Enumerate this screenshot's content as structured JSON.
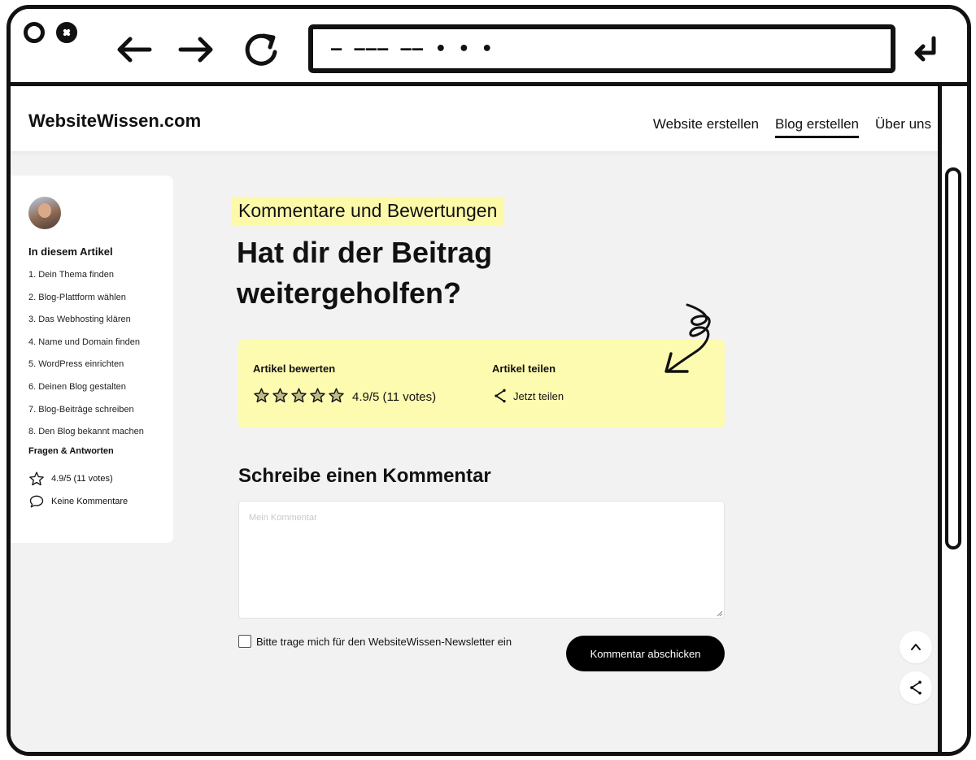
{
  "browser": {
    "url_text": "— ——— —— • • •"
  },
  "site": {
    "logo": "WebsiteWissen.com",
    "nav": [
      {
        "label": "Website erstellen",
        "active": false
      },
      {
        "label": "Blog erstellen",
        "active": true
      },
      {
        "label": "Über uns",
        "active": false
      }
    ]
  },
  "sidebar": {
    "title": "In diesem Artikel",
    "items": [
      "1. Dein Thema finden",
      "2. Blog-Plattform wählen",
      "3. Das Webhosting klären",
      "4. Name und Domain finden",
      "5. WordPress einrichten",
      "6. Deinen Blog gestalten",
      "7. Blog-Beiträge schreiben",
      "8. Den Blog bekannt machen"
    ],
    "faq": "Fragen & Antworten",
    "rating": "4.9/5 (11 votes)",
    "comments": "Keine Kommentare"
  },
  "main": {
    "eyebrow": "Kommentare und Bewertungen",
    "headline": "Hat dir der Beitrag weitergeholfen?",
    "rate_label": "Artikel bewerten",
    "rating_value": 4.9,
    "rating_max": 5,
    "rating_text": "4.9/5 (11 votes)",
    "share_label": "Artikel teilen",
    "share_link": "Jetzt teilen",
    "comment_title": "Schreibe einen Kommentar",
    "comment_placeholder": "Mein Kommentar",
    "newsletter_label": "Bitte trage mich für den WebsiteWissen-Newsletter ein",
    "submit_label": "Kommentar abschicken"
  },
  "icons": {
    "window_close": "circle-icon",
    "window_x": "x-circle-icon",
    "back": "arrow-left-icon",
    "forward": "arrow-right-icon",
    "reload": "reload-icon",
    "enter": "enter-icon",
    "star": "star-icon",
    "comment": "speech-bubble-icon",
    "share": "share-icon",
    "scroll_top": "chevron-up-icon"
  },
  "colors": {
    "highlight": "#fcf9a9",
    "rating_box": "#fdfbb0",
    "page_bg": "#f2f2f2",
    "button": "#000000"
  }
}
